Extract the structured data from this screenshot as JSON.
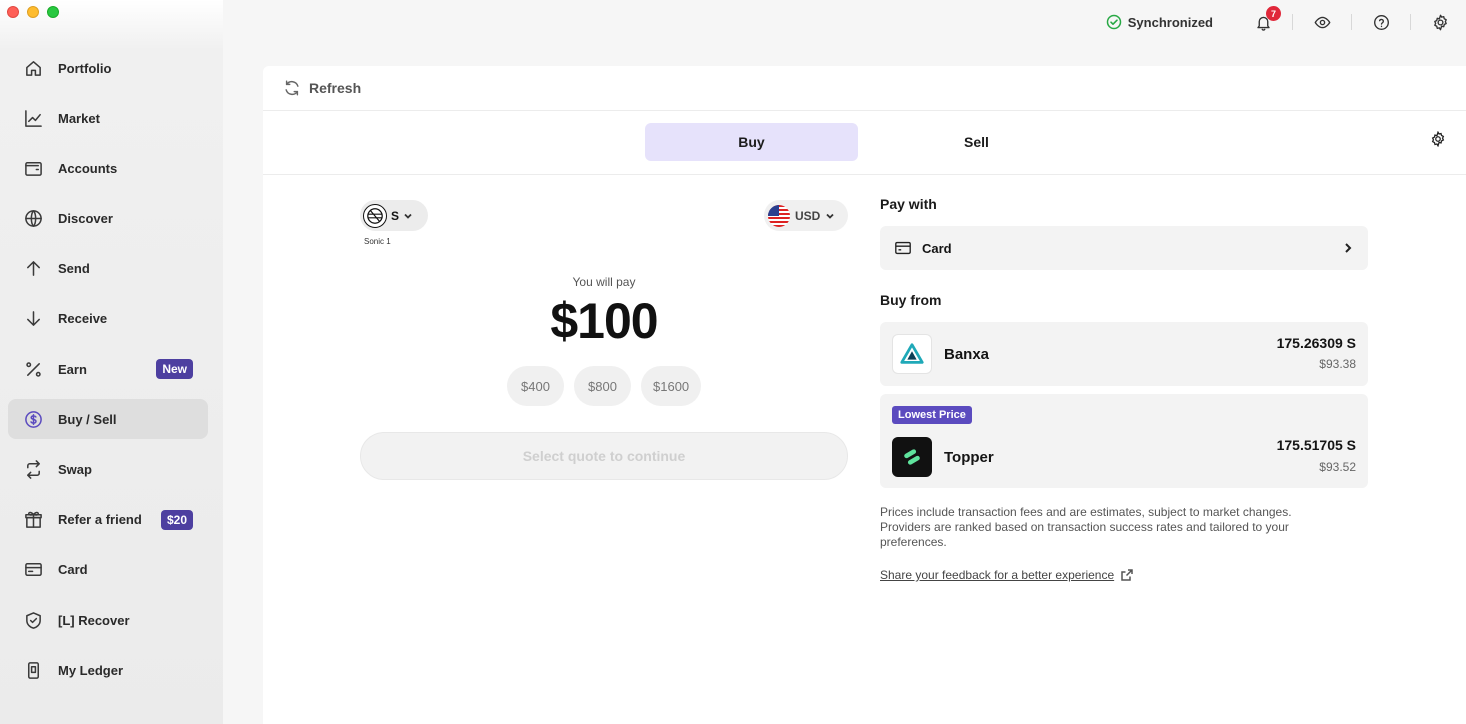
{
  "window": {
    "controls": [
      "close",
      "minimize",
      "zoom"
    ]
  },
  "sidebar": {
    "items": [
      {
        "label": "Portfolio",
        "icon": "home-icon"
      },
      {
        "label": "Market",
        "icon": "chart-icon"
      },
      {
        "label": "Accounts",
        "icon": "wallet-icon"
      },
      {
        "label": "Discover",
        "icon": "globe-icon"
      },
      {
        "label": "Send",
        "icon": "arrow-up-icon"
      },
      {
        "label": "Receive",
        "icon": "arrow-down-icon"
      },
      {
        "label": "Earn",
        "icon": "percent-icon",
        "badge": "New"
      },
      {
        "label": "Buy / Sell",
        "icon": "dollar-circle-icon",
        "active": true
      },
      {
        "label": "Swap",
        "icon": "swap-icon"
      },
      {
        "label": "Refer a friend",
        "icon": "gift-icon",
        "badge": "$20"
      },
      {
        "label": "Card",
        "icon": "card-icon"
      },
      {
        "label": "[L] Recover",
        "icon": "shield-icon"
      },
      {
        "label": "My Ledger",
        "icon": "device-icon"
      }
    ]
  },
  "topbar": {
    "sync_status": "Synchronized",
    "notification_count": "7"
  },
  "panel": {
    "refresh_label": "Refresh",
    "tabs": {
      "buy": "Buy",
      "sell": "Sell"
    },
    "left": {
      "asset_symbol": "S",
      "asset_caption": "Sonic 1",
      "currency": "USD",
      "pay_label": "You will pay",
      "amount": "$100",
      "presets": [
        "$400",
        "$800",
        "$1600"
      ],
      "continue_label": "Select quote to continue"
    },
    "right": {
      "pay_with_title": "Pay with",
      "pay_method": "Card",
      "buy_from_title": "Buy from",
      "providers": [
        {
          "name": "Banxa",
          "crypto_amount": "175.26309 S",
          "fiat_amount": "$93.38"
        },
        {
          "name": "Topper",
          "crypto_amount": "175.51705 S",
          "fiat_amount": "$93.52",
          "tag": "Lowest Price"
        }
      ],
      "disclaimer": "Prices include transaction fees and are estimates, subject to market changes. Providers are ranked based on transaction success rates and tailored to your preferences.",
      "feedback_link": "Share your feedback for a better experience"
    }
  },
  "colors": {
    "accent_purple": "#4d3fa0",
    "buy_tab_bg": "#e6e2fb",
    "notification_red": "#e0283a",
    "sync_green": "#27a844"
  }
}
